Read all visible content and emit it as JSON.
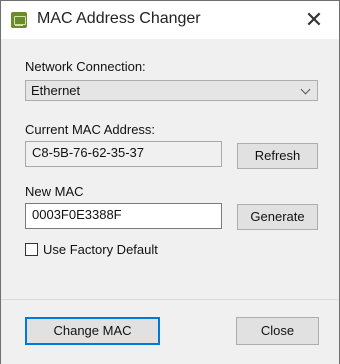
{
  "window": {
    "title": "MAC Address Changer",
    "close_glyph": "✕"
  },
  "network": {
    "label": "Network Connection:",
    "selected": "Ethernet"
  },
  "current_mac": {
    "label": "Current MAC Address:",
    "value": "C8-5B-76-62-35-37",
    "refresh_label": "Refresh"
  },
  "new_mac": {
    "label": "New MAC",
    "value": "0003F0E3388F",
    "generate_label": "Generate"
  },
  "factory_default": {
    "label": "Use Factory Default",
    "checked": false
  },
  "footer": {
    "change_label": "Change MAC",
    "close_label": "Close"
  }
}
